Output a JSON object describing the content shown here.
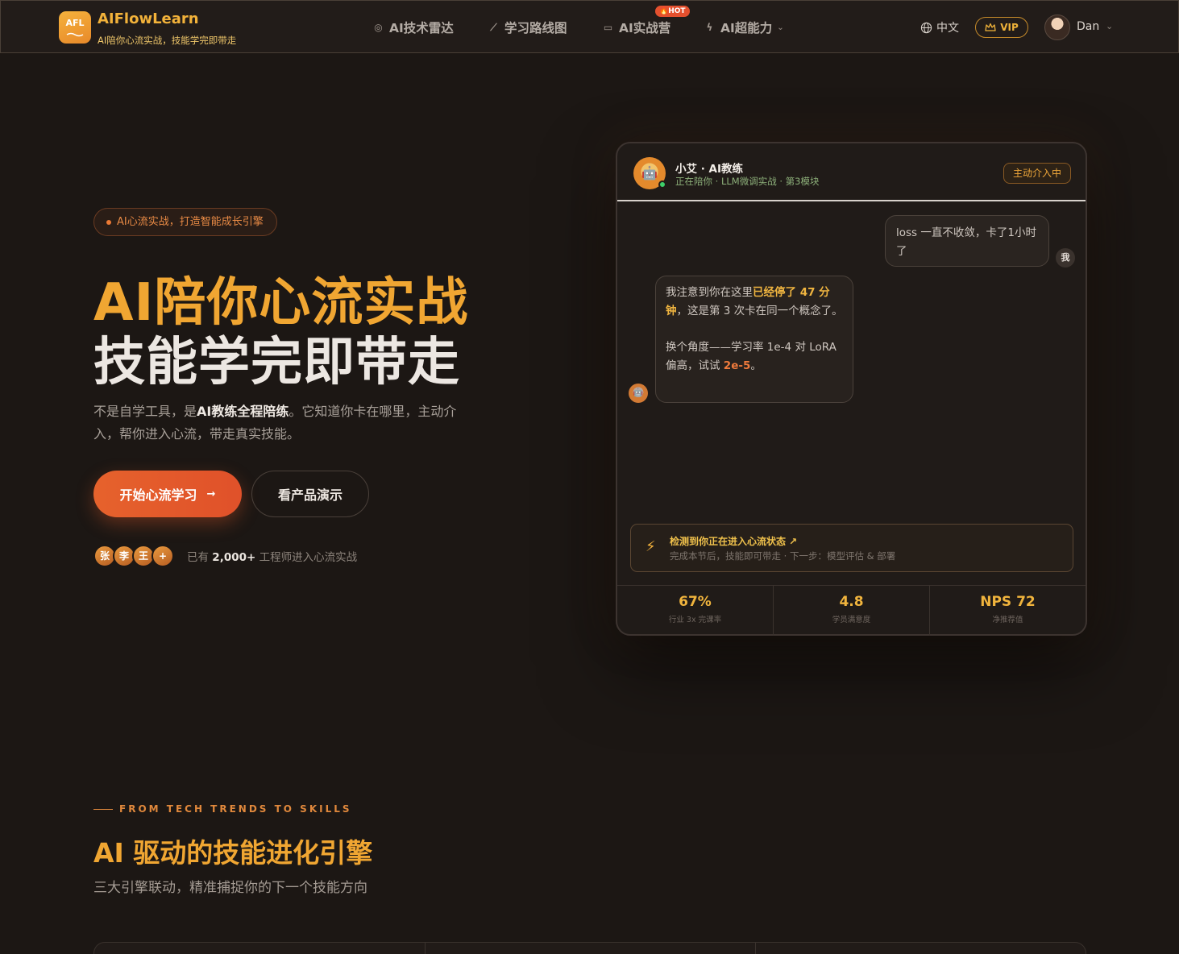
{
  "brand": {
    "logo_text": "AFL",
    "name": "AIFlowLearn",
    "slogan": "AI陪你心流实战，技能学完即带走"
  },
  "nav": {
    "items": [
      {
        "label": "AI技术雷达",
        "icon": "radar-icon"
      },
      {
        "label": "学习路线图",
        "icon": "stairs-icon"
      },
      {
        "label": "AI实战营",
        "icon": "terminal-icon",
        "badge": "🔥HOT"
      },
      {
        "label": "AI超能力",
        "icon": "lightning-icon",
        "has_dropdown": true
      }
    ]
  },
  "header_right": {
    "language": "中文",
    "vip_label": "VIP",
    "user_name": "Dan"
  },
  "hero": {
    "tagline": "AI心流实战，打造智能成长引擎",
    "title_line1": "AI陪你心流实战",
    "title_line2": "技能学完即带走",
    "desc_prefix": "不是自学工具，是",
    "desc_bold": "AI教练全程陪练",
    "desc_suffix": "。它知道你卡在哪里，主动介入，帮你进入心流，带走真实技能。",
    "cta_primary": "开始心流学习",
    "cta_secondary": "看产品演示",
    "mini_avatars": [
      "张",
      "李",
      "王",
      "+"
    ],
    "social_prefix": "已有",
    "social_count": "2,000+",
    "social_suffix": "工程师进入心流实战"
  },
  "chat": {
    "bot_name": "小艾 · AI教练",
    "bot_status": "正在陪你 · LLM微调实战 · 第3模块",
    "badge": "主动介入中",
    "user_message": "loss 一直不收敛，卡了1小时了",
    "me_label": "我",
    "bot_msg_part1": "我注意到你在这里",
    "bot_msg_highlight1": "已经停了 47 分钟",
    "bot_msg_part2": "，这是第 3 次卡在同一个概念了。",
    "bot_msg_part3": "换个角度——学习率 1e-4 对 LoRA 偏高，试试 ",
    "bot_msg_highlight2": "2e-5",
    "bot_msg_part4": "。",
    "flow_title": "检测到你正在进入心流状态 ↗",
    "flow_sub": "完成本节后，技能即可带走 · 下一步：模型评估 & 部署",
    "stats": [
      {
        "value": "67%",
        "label": "行业 3x 完课率"
      },
      {
        "value": "4.8",
        "label": "学员满意度"
      },
      {
        "value": "NPS 72",
        "label": "净推荐值"
      }
    ]
  },
  "section2": {
    "eyebrow": "FROM TECH TRENDS TO SKILLS",
    "title": "AI 驱动的技能进化引擎",
    "subtitle": "三大引擎联动，精准捕捉你的下一个技能方向"
  },
  "colors": {
    "accent_orange": "#e6622c",
    "accent_gold": "#f0a632",
    "background": "#1c1714"
  }
}
